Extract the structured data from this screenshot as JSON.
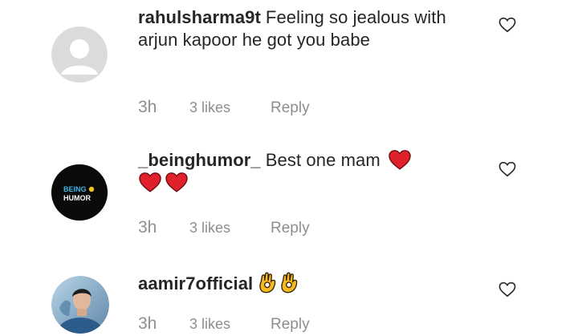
{
  "comments": [
    {
      "username": "rahulsharma9t",
      "text": "Feeling so jealous with arjun kapoor he got you babe",
      "time": "3h",
      "likes": "3 likes",
      "reply": "Reply"
    },
    {
      "username": "_beinghumor_",
      "text": "Best one mam",
      "avatar_text_1": "BEING",
      "avatar_text_2": "HUMOR",
      "time": "3h",
      "likes": "3 likes",
      "reply": "Reply"
    },
    {
      "username": "aamir7official",
      "text": "",
      "time": "3h",
      "likes": "3 likes",
      "reply": "Reply"
    }
  ],
  "icons": {
    "like": "heart-outline-icon",
    "emoji_heart": "red-heart-emoji",
    "emoji_ok": "ok-hand-emoji"
  },
  "colors": {
    "text": "#262626",
    "meta": "#8e8e8e",
    "heart_red": "#e0202a",
    "emoji_yellow": "#f7b821"
  }
}
